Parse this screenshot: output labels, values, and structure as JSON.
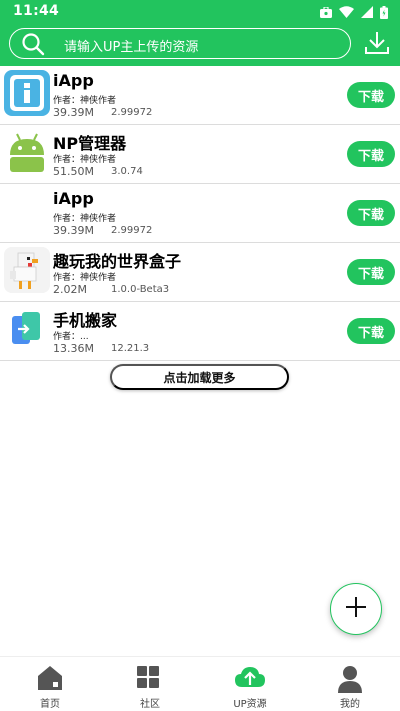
{
  "status": {
    "time": "11:44"
  },
  "search": {
    "placeholder": "请输入UP主上传的资源"
  },
  "apps": [
    {
      "name": "iApp",
      "author": "作者：神侠作者",
      "size": "39.39M",
      "version": "2.99972"
    },
    {
      "name": "NP管理器",
      "author": "作者：神侠作者",
      "size": "51.50M",
      "version": "3.0.74"
    },
    {
      "name": "iApp",
      "author": "作者：神侠作者",
      "size": "39.39M",
      "version": "2.99972"
    },
    {
      "name": "趣玩我的世界盒子",
      "author": "作者：神侠作者",
      "size": "2.02M",
      "version": "1.0.0-Beta3"
    },
    {
      "name": "手机搬家",
      "author": "作者：...",
      "size": "13.36M",
      "version": "12.21.3"
    }
  ],
  "download_label": "下载",
  "load_more": "点击加载更多",
  "nav": [
    {
      "label": "首页",
      "icon": "home-icon"
    },
    {
      "label": "社区",
      "icon": "community-icon"
    },
    {
      "label": "UP资源",
      "icon": "cloud-upload-icon"
    },
    {
      "label": "我的",
      "icon": "profile-icon"
    }
  ],
  "colors": {
    "accent": "#22c45e"
  }
}
